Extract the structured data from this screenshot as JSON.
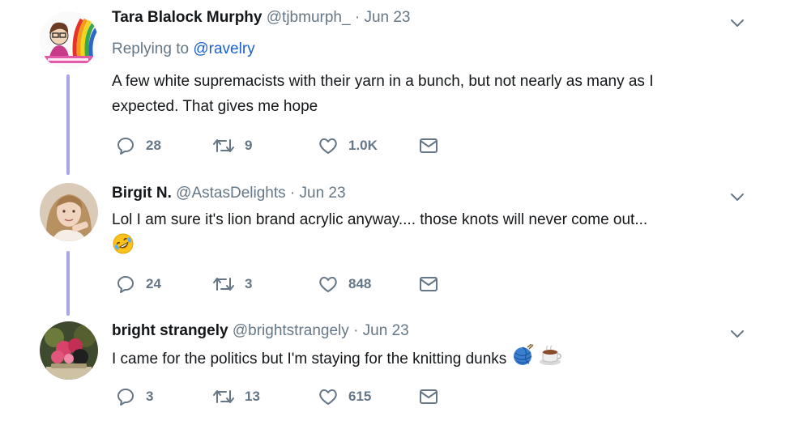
{
  "tweets": [
    {
      "name": "Tara Blalock Murphy",
      "handle": "@tjbmurph_",
      "separator": "·",
      "date": "Jun 23",
      "replying_prefix": "Replying to",
      "replying_handle": "@ravelry",
      "text_line1": "A few white supremacists with their yarn in a bunch, but not nearly as many as I",
      "text_line2": "expected. That gives me hope",
      "replies": "28",
      "retweets": "9",
      "likes": "1.0K"
    },
    {
      "name": "Birgit N.",
      "handle": "@AstasDelights",
      "separator": "·",
      "date": "Jun 23",
      "text_line1": "Lol I am sure it's lion brand acrylic anyway.... those knots will never come out...",
      "emoji": "rolling-on-floor-laughing-emoji",
      "replies": "24",
      "retweets": "3",
      "likes": "848"
    },
    {
      "name": "bright strangely",
      "handle": "@brightstrangely",
      "separator": "·",
      "date": "Jun 23",
      "text_line1": "I came for the politics but I'm staying for the knitting dunks",
      "emoji": [
        "yarn-ball-emoji",
        "coffee-cup-emoji"
      ],
      "replies": "3",
      "retweets": "13",
      "likes": "615"
    }
  ],
  "icons": {
    "reply": "reply-icon",
    "retweet": "retweet-icon",
    "like": "heart-icon",
    "message": "envelope-icon",
    "caret": "chevron-down-icon"
  },
  "colors": {
    "thread_line": "#a8a6e8",
    "link": "#1b5fd0",
    "muted": "#657786",
    "text": "#14171a"
  }
}
